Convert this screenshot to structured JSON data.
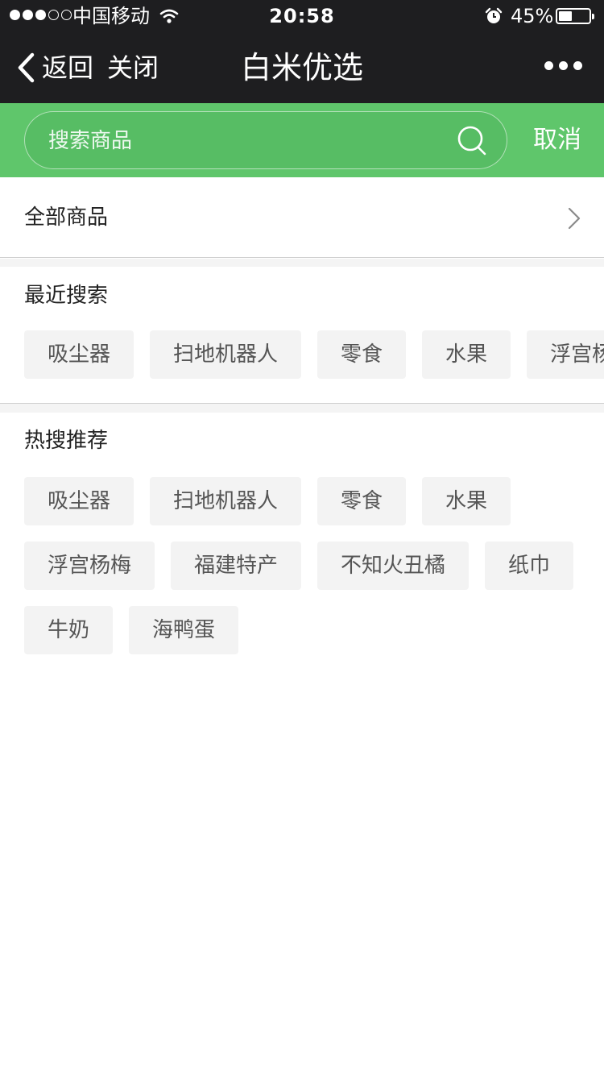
{
  "status_bar": {
    "signal_dots_filled": 3,
    "signal_dots_total": 5,
    "carrier": "中国移动",
    "time": "20:58",
    "battery_percent": "45%",
    "battery_level": 0.45,
    "icons": [
      "wifi-icon",
      "alarm-icon",
      "battery-icon"
    ]
  },
  "nav": {
    "back_label": "返回",
    "close_label": "关闭",
    "title": "白米优选",
    "icons": [
      "chevron-left-icon",
      "more-icon"
    ]
  },
  "search": {
    "placeholder": "搜索商品",
    "cancel_label": "取消",
    "icon": "search-icon",
    "accent_color": "#5fc66b"
  },
  "all_goods": {
    "label": "全部商品",
    "icon": "chevron-right-icon"
  },
  "recent": {
    "heading": "最近搜索",
    "tags": [
      "吸尘器",
      "扫地机器人",
      "零食",
      "水果",
      "浮宫杨梅"
    ]
  },
  "hot": {
    "heading": "热搜推荐",
    "tags": [
      "吸尘器",
      "扫地机器人",
      "零食",
      "水果",
      "浮宫杨梅",
      "福建特产",
      "不知火丑橘",
      "纸巾",
      "牛奶",
      "海鸭蛋"
    ]
  }
}
